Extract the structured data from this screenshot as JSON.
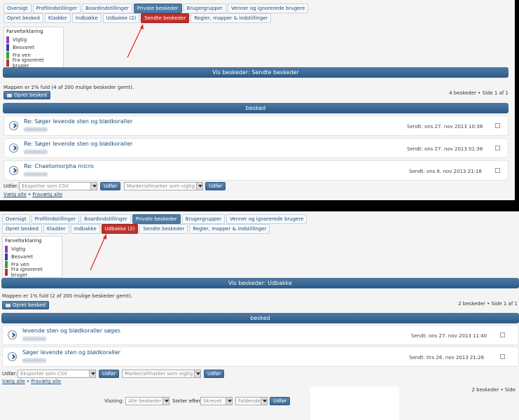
{
  "top": {
    "tabs_row1": [
      "Oversigt",
      "Profilindstillinger",
      "Boardindstillinger",
      "Private beskeder",
      "Brugergrupper",
      "Venner og ignorerede brugere"
    ],
    "tabs_row2": [
      "Opret besked",
      "Kladder",
      "Indbakke",
      "Udbakke (2)",
      "Sendte beskeder",
      "Regler, mapper & indstillinger"
    ],
    "legend": {
      "title": "Farveforklaring",
      "items": [
        {
          "label": "Vigtig",
          "color": "#8a3fb8"
        },
        {
          "label": "Besvaret",
          "color": "#3a3fa6"
        },
        {
          "label": "Fra ven",
          "color": "#35a235"
        },
        {
          "label": "Fra ignoreret bruger",
          "color": "#b2322e"
        }
      ]
    },
    "header": "Vis beskeder: Sendte beskeder",
    "folder_info": "Mappen er 2% fuld (4 af 200 mulige beskeder gemt).",
    "new_message": "Opret besked",
    "pagination": "4 beskeder • Side 1 af 1",
    "column_header": "besked",
    "messages": [
      {
        "subject": "Re: Søger levende sten og blødkoraller",
        "sent": "Sendt: ons 27. nov 2013 10:38"
      },
      {
        "subject": "Re: Søger levende sten og blødkoraller",
        "sent": "Sendt: ons 27. nov 2013 01:38"
      },
      {
        "subject": "Re: Chaetomorpha micro",
        "sent": "Sendt: ons 6. nov 2013 21:18"
      }
    ],
    "udfor_label": "Udfør:",
    "export_select": "Eksporter som CSV",
    "go_button": "Udfør",
    "mark_select": "Marker/afmarker som vigtig",
    "select_all": "Vælg alle",
    "deselect_all": "Fravælg alle"
  },
  "bottom": {
    "tabs_row1": [
      "Oversigt",
      "Profilindstillinger",
      "Boardindstillinger",
      "Private beskeder",
      "Brugergrupper",
      "Venner og ignorerede brugere"
    ],
    "tabs_row2": [
      "Opret besked",
      "Kladder",
      "Indbakke",
      "Udbakke (2)",
      "Sendte beskeder",
      "Regler, mapper & indstillinger"
    ],
    "legend": {
      "title": "Farveforklaring",
      "items": [
        {
          "label": "Vigtig",
          "color": "#8a3fb8"
        },
        {
          "label": "Besvaret",
          "color": "#3a3fa6"
        },
        {
          "label": "Fra ven",
          "color": "#35a235"
        },
        {
          "label": "Fra ignoreret bruger",
          "color": "#b2322e"
        }
      ]
    },
    "header": "Vis beskeder: Udbakke",
    "folder_info": "Mappen er 1% fuld (2 af 200 mulige beskeder gemt).",
    "new_message": "Opret besked",
    "pagination": "2 beskeder • Side 1 af 1",
    "column_header": "besked",
    "messages": [
      {
        "subject": "levende sten og blødkoraller søges",
        "sent": "Sendt: ons 27. nov 2013 11:40"
      },
      {
        "subject": "Søger levende sten og blødkoraller",
        "sent": "Sendt: tirs 26. nov 2013 21:26"
      }
    ],
    "udfor_label": "Udfør:",
    "export_select": "Eksporter som CSV",
    "go_button": "Udfør",
    "mark_select": "Marker/afmarker som vigtig",
    "select_all": "Vælg alle",
    "deselect_all": "Fravælg alle",
    "pagination_bottom": "2 beskeder • Side",
    "view_label": "Visning:",
    "view_select": "Alle beskeder",
    "sort_label": "Sorter efter",
    "sort_select": "Skrevet",
    "order_select": "Faldende",
    "sort_go": "Udfør"
  }
}
